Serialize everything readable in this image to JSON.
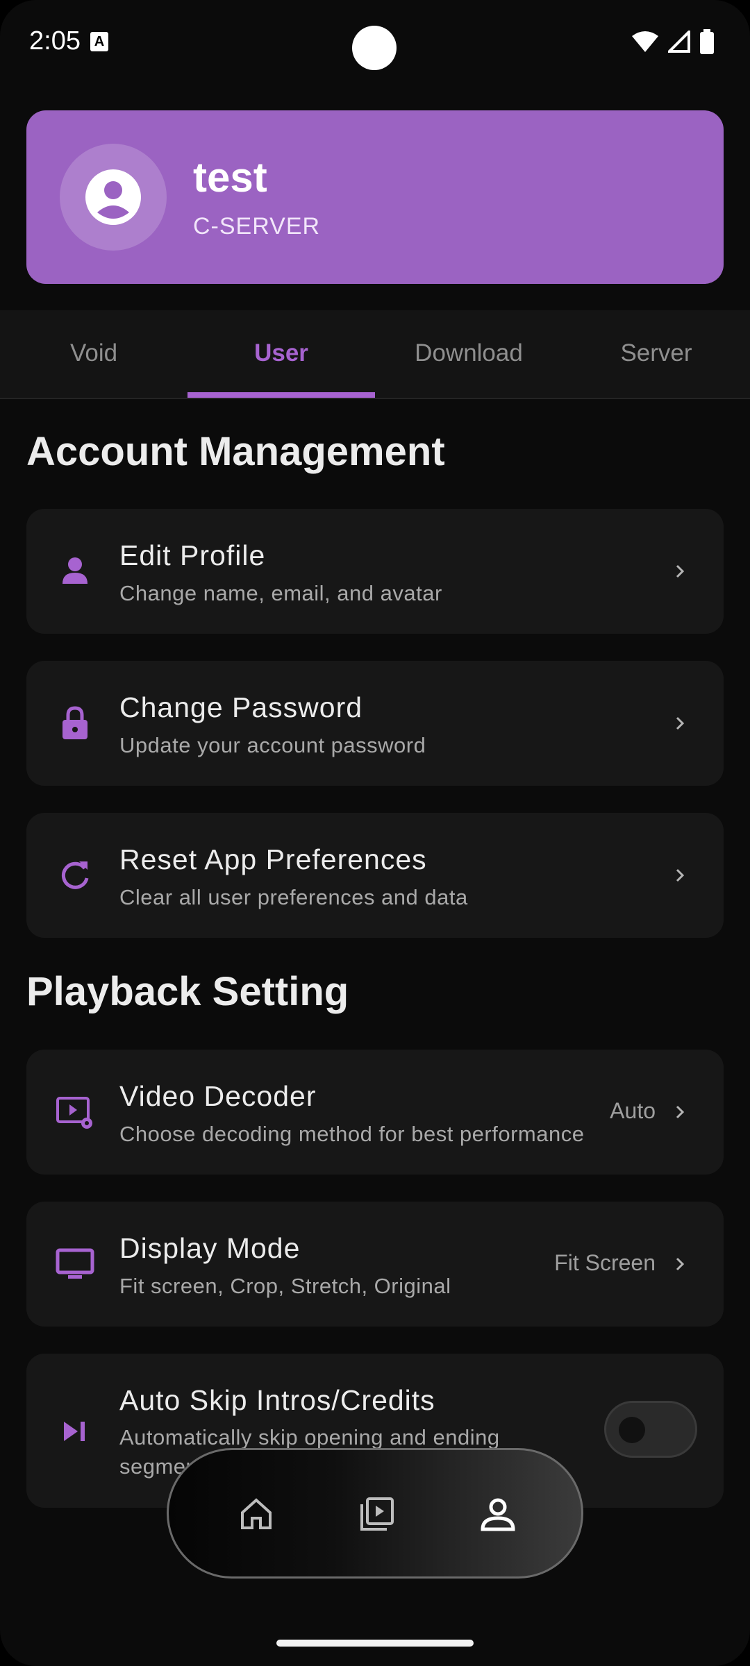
{
  "status_bar": {
    "time": "2:05",
    "notification_icon": "a-box-icon",
    "icons": [
      "wifi-icon",
      "signal-icon",
      "battery-icon"
    ]
  },
  "profile": {
    "name": "test",
    "server": "C-SERVER",
    "avatar_icon": "account-circle-icon"
  },
  "tabs": [
    {
      "label": "Void",
      "active": false
    },
    {
      "label": "User",
      "active": true
    },
    {
      "label": "Download",
      "active": false
    },
    {
      "label": "Server",
      "active": false
    }
  ],
  "account_section": {
    "title": "Account Management",
    "items": [
      {
        "title": "Edit Profile",
        "subtitle": "Change name, email, and avatar",
        "icon": "person-icon"
      },
      {
        "title": "Change Password",
        "subtitle": "Update your account password",
        "icon": "lock-icon"
      },
      {
        "title": "Reset App Preferences",
        "subtitle": "Clear all user preferences and data",
        "icon": "refresh-icon"
      }
    ]
  },
  "playback_section": {
    "title": "Playback Setting",
    "items": [
      {
        "title": "Video Decoder",
        "subtitle": "Choose decoding method for best performance",
        "value": "Auto",
        "icon": "video-settings-icon"
      },
      {
        "title": "Display Mode",
        "subtitle": "Fit screen, Crop, Stretch, Original",
        "value": "Fit Screen",
        "icon": "monitor-icon"
      },
      {
        "title": "Auto Skip Intros/Credits",
        "subtitle": "Automatically skip opening and ending segments",
        "icon": "skip-next-icon",
        "toggle_on": false
      }
    ]
  },
  "bottom_nav": {
    "items": [
      "home-icon",
      "library-icon",
      "profile-icon"
    ],
    "active": "profile-icon"
  },
  "colors": {
    "accent": "#a763d0",
    "card": "#9b63c2",
    "background": "#0b0b0b"
  }
}
